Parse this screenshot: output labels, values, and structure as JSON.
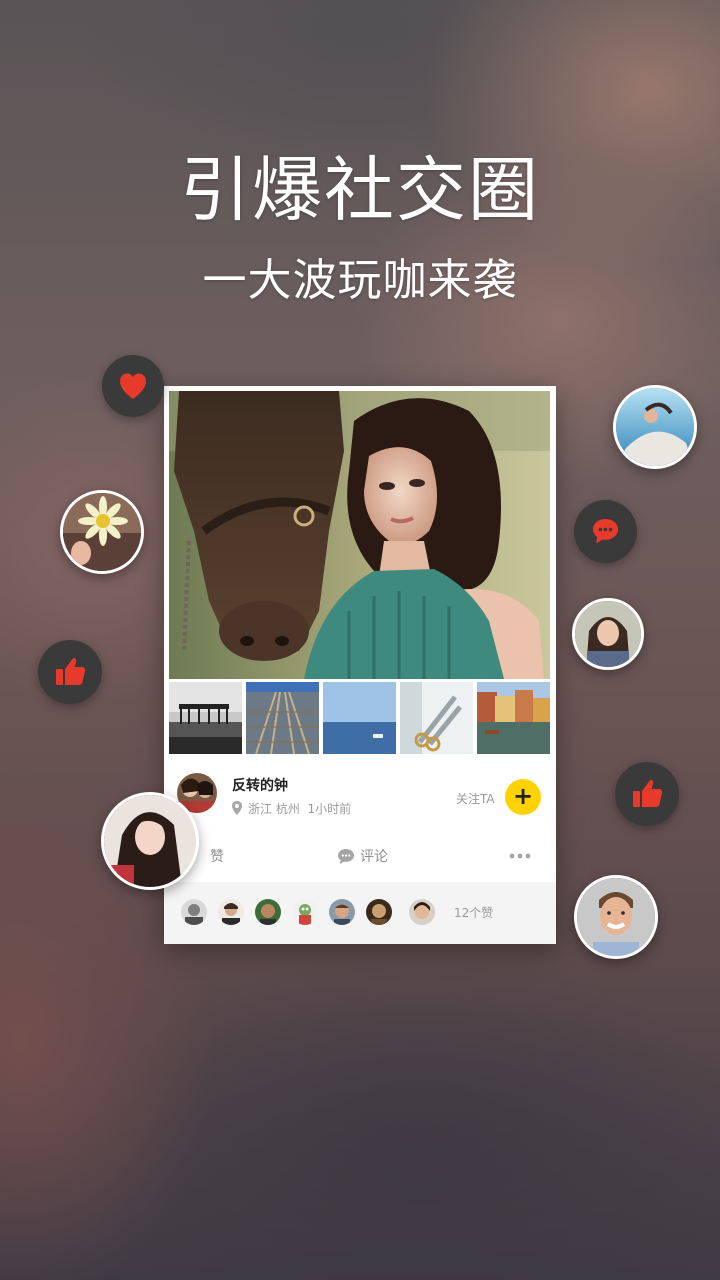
{
  "headline": {
    "line1": "引爆社交圈",
    "line2": "一大波玩咖来袭"
  },
  "post": {
    "author_name": "反转的钟",
    "location": "浙江 杭州",
    "time_ago": "1小时前",
    "location_line": "浙江 杭州  1小时前",
    "follow_label": "关注TA",
    "follow_button": "+",
    "like_label": "赞",
    "comment_label": "评论",
    "likes_count": "12个赞",
    "thumbnails": [
      "pier-bw",
      "railway",
      "ocean-boat",
      "scissors",
      "canal-town"
    ]
  },
  "floating": {
    "icons": [
      "heart-icon",
      "chat-icon",
      "thumbs-up-icon",
      "thumbs-up-icon"
    ],
    "avatars": [
      "underwater-avatar",
      "flower-avatar",
      "girl-avatar",
      "long-hair-avatar",
      "smiling-man-avatar"
    ]
  },
  "colors": {
    "accent_red": "#e83a2a",
    "follow_yellow": "#ffd200",
    "bubble_dark": "#3a3a3a",
    "card_bg": "#ffffff"
  }
}
